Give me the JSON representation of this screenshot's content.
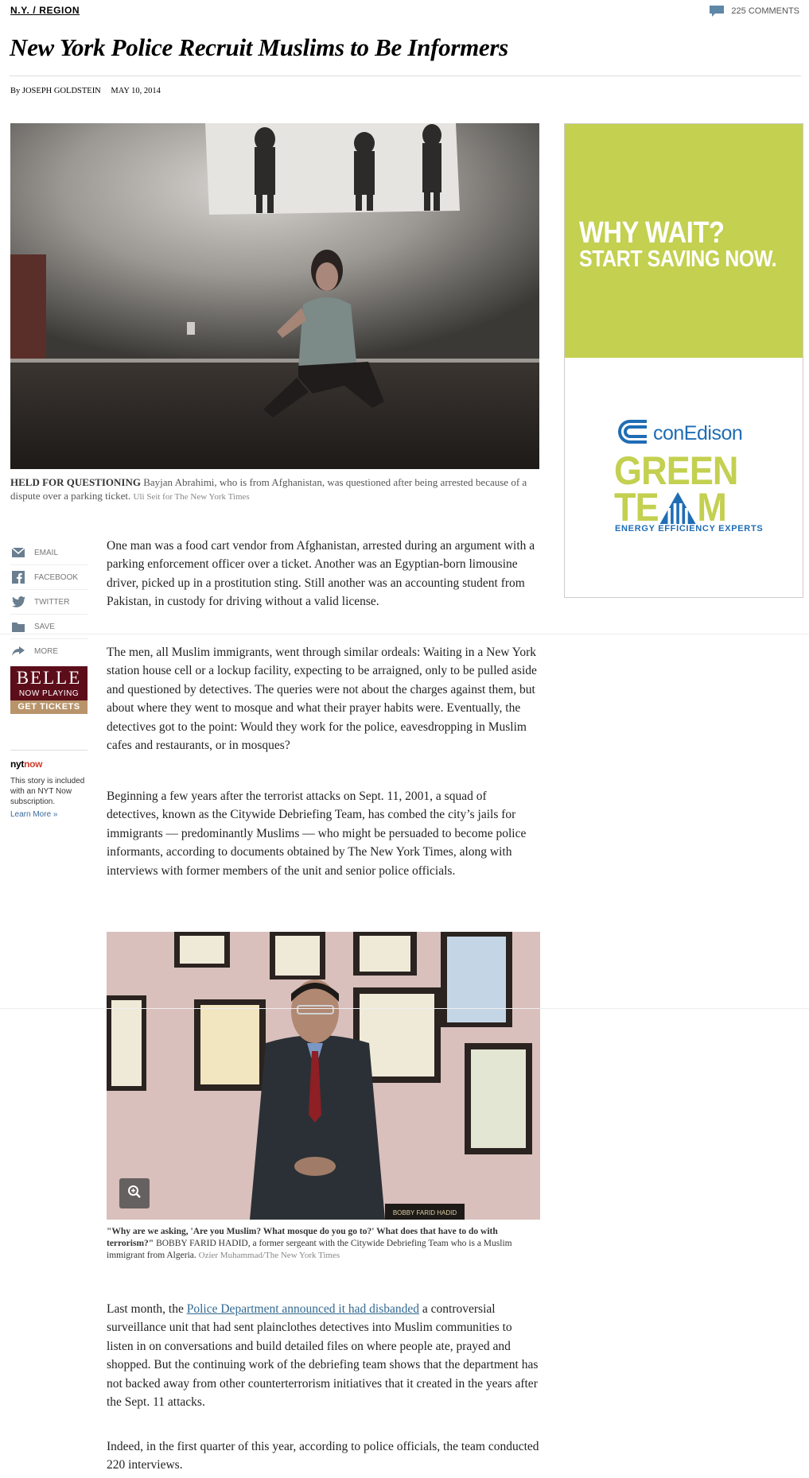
{
  "header": {
    "kicker": "N.Y. / REGION",
    "comments_count": "225 COMMENTS"
  },
  "article": {
    "headline": "New York Police Recruit Muslims to Be Informers",
    "byline_prefix": "By",
    "author": "JOSEPH GOLDSTEIN",
    "date": "MAY 10, 2014"
  },
  "lead_photo": {
    "caption_label": "HELD FOR QUESTIONING",
    "caption_text": "Bayjan Abrahimi, who is from Afghanistan, was questioned after being arrested because of a dispute over a parking ticket.",
    "credit": "Uli Seit for The New York Times"
  },
  "share": {
    "items": [
      {
        "label": "EMAIL",
        "icon": "email-icon"
      },
      {
        "label": "FACEBOOK",
        "icon": "facebook-icon"
      },
      {
        "label": "TWITTER",
        "icon": "twitter-icon"
      },
      {
        "label": "SAVE",
        "icon": "save-icon"
      },
      {
        "label": "MORE",
        "icon": "share-arrow-icon"
      }
    ]
  },
  "belle_ad": {
    "title": "BELLE",
    "subtitle": "NOW PLAYING",
    "cta": "GET TICKETS"
  },
  "nytnow": {
    "logo_a": "nyt",
    "logo_b": "now",
    "text": "This story is included with an NYT Now subscription.",
    "link": "Learn More »"
  },
  "body": {
    "p1": "One man was a food cart vendor from Afghanistan, arrested during an argument with a parking enforcement officer over a ticket. Another was an Egyptian-born limousine driver, picked up in a prostitution sting. Still another was an accounting student from Pakistan, in custody for driving without a valid license.",
    "p2": "The men, all Muslim immigrants, went through similar ordeals: Waiting in a New York station house cell or a lockup facility, expecting to be arraigned, only to be pulled aside and questioned by detectives. The queries were not about the charges against them, but about where they went to mosque and what their prayer habits were. Eventually, the detectives got to the point: Would they work for the police, eavesdropping in Muslim cafes and restaurants, or in mosques?",
    "p3": "Beginning a few years after the terrorist attacks on Sept. 11, 2001, a squad of detectives, known as the Citywide Debriefing Team, has combed the city’s jails for immigrants — predominantly Muslims — who might be persuaded to become police informants, according to documents obtained by The New York Times, along with interviews with former members of the unit and senior police officials.",
    "p4_pre": "Last month, the ",
    "p4_link": "Police Department announced it had disbanded",
    "p4_post": " a controversial surveillance unit that had sent plainclothes detectives into Muslim communities to listen in on conversations and build detailed files on where people ate, prayed and shopped. But the continuing work of the debriefing team shows that the department has not backed away from other counterterrorism initiatives that it created in the years after the Sept. 11 attacks.",
    "p5": "Indeed, in the first quarter of this year, according to police officials, the team conducted 220 interviews."
  },
  "second_photo": {
    "quote": "\"Why are we asking, 'Are you Muslim? What mosque do you go to?' What does that have to do with terrorism?\"",
    "caption_text": "BOBBY FARID HADID, a former sergeant with the Citywide Debriefing Team who is a Muslim immigrant from Algeria.",
    "credit": "Ozier Muhammad/The New York Times",
    "nameplate": "BOBBY FARID HADID"
  },
  "ad": {
    "headline1": "WHY WAIT?",
    "headline2": "START SAVING NOW.",
    "brand": "conEdison",
    "green_word_1": "GREEN",
    "green_word_2a": "TE",
    "green_word_2b": "M",
    "tagline": "ENERGY EFFICIENCY EXPERTS",
    "colors": {
      "green": "#c3d050",
      "blue": "#1f6db5"
    }
  }
}
